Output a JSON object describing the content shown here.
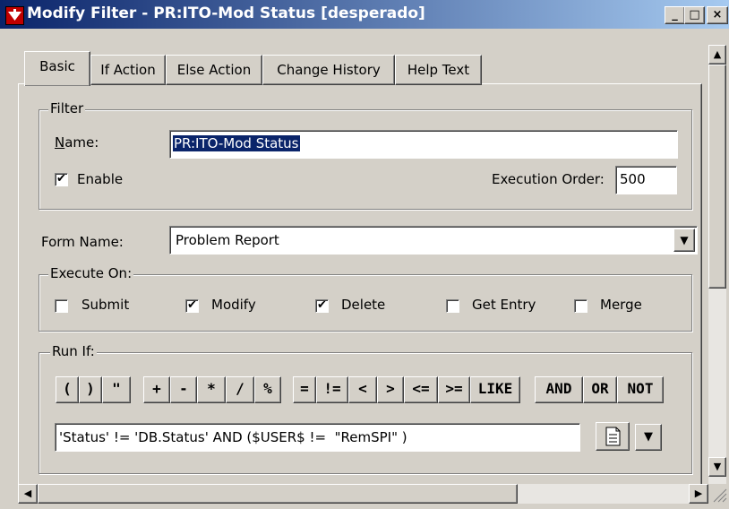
{
  "window": {
    "title": "Modify Filter - PR:ITO-Mod Status [desperado]",
    "minimize": "_",
    "maximize": "□",
    "close": "×"
  },
  "tabs": [
    "Basic",
    "If Action",
    "Else Action",
    "Change History",
    "Help Text"
  ],
  "filter_group": {
    "legend": "Filter",
    "name_label": "Name:",
    "name_value": "PR:ITO-Mod Status",
    "enable_label": "Enable",
    "enable_checked": true,
    "exec_order_label": "Execution Order:",
    "exec_order_value": "500"
  },
  "form_name": {
    "label": "Form Name:",
    "value": "Problem Report"
  },
  "execute_on": {
    "legend": "Execute On:",
    "options": [
      {
        "label": "Submit",
        "checked": false
      },
      {
        "label": "Modify",
        "checked": true
      },
      {
        "label": "Delete",
        "checked": true
      },
      {
        "label": "Get Entry",
        "checked": false
      },
      {
        "label": "Merge",
        "checked": false
      }
    ]
  },
  "run_if": {
    "legend": "Run If:",
    "operators": [
      "(",
      ")",
      "\"",
      "+",
      "-",
      "*",
      "/",
      "%",
      "=",
      "!=",
      "<",
      ">",
      "<=",
      ">=",
      "LIKE",
      "AND",
      "OR",
      "NOT"
    ],
    "qualification": "'Status' != 'DB.Status' AND ($USER$ !=  \"RemSPI\" )"
  },
  "icons": {
    "check": "✔",
    "dropdown": "▼",
    "scroll_up": "▲",
    "scroll_down": "▼",
    "scroll_left": "◀",
    "scroll_right": "▶"
  }
}
